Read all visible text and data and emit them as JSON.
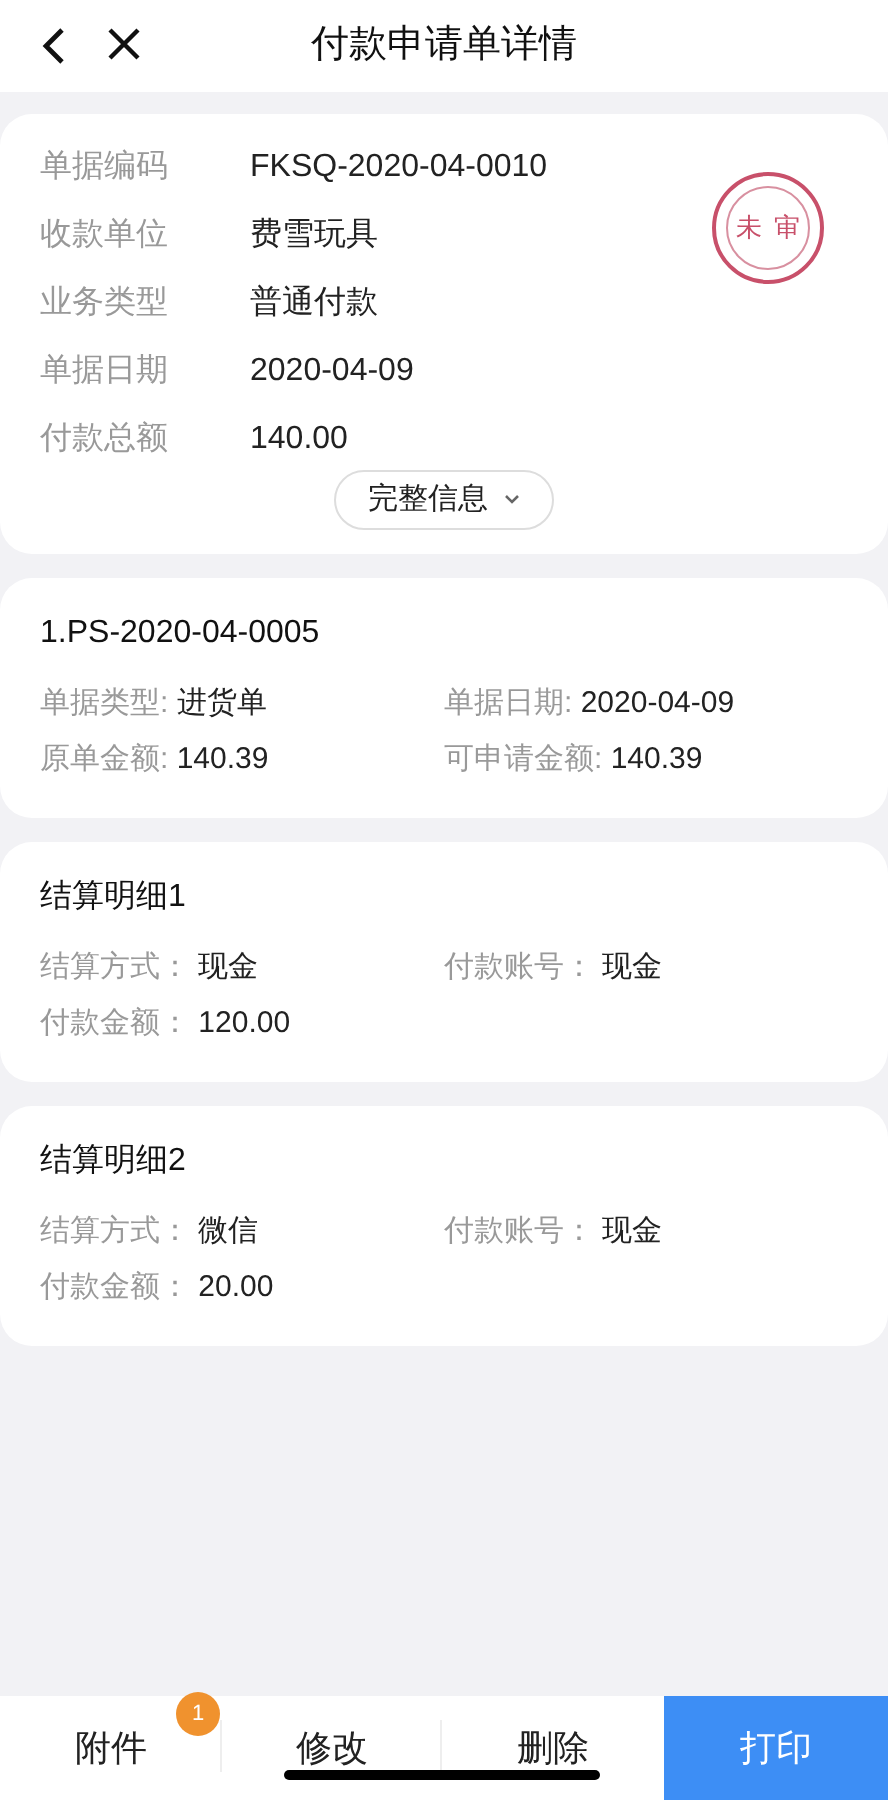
{
  "header": {
    "title": "付款申请单详情"
  },
  "summary": {
    "fields": [
      {
        "label": "单据编码",
        "value": "FKSQ-2020-04-0010"
      },
      {
        "label": "收款单位",
        "value": "费雪玩具"
      },
      {
        "label": "业务类型",
        "value": "普通付款"
      },
      {
        "label": "单据日期",
        "value": "2020-04-09"
      },
      {
        "label": "付款总额",
        "value": "140.00"
      }
    ],
    "stamp": "未审",
    "more_button": "完整信息"
  },
  "sections": [
    {
      "title": "1.PS-2020-04-0005",
      "fields": [
        {
          "label": "单据类型: ",
          "value": "进货单"
        },
        {
          "label": "单据日期: ",
          "value": "2020-04-09"
        },
        {
          "label": "原单金额: ",
          "value": "140.39"
        },
        {
          "label": "可申请金额: ",
          "value": "140.39"
        }
      ]
    },
    {
      "title": "结算明细1",
      "fields": [
        {
          "label": "结算方式： ",
          "value": "现金"
        },
        {
          "label": "付款账号： ",
          "value": "现金"
        },
        {
          "label": "付款金额： ",
          "value": "120.00"
        }
      ]
    },
    {
      "title": "结算明细2",
      "fields": [
        {
          "label": "结算方式： ",
          "value": "微信"
        },
        {
          "label": "付款账号： ",
          "value": "现金"
        },
        {
          "label": "付款金额： ",
          "value": "20.00"
        }
      ]
    }
  ],
  "bottom_bar": {
    "actions": [
      {
        "label": "附件",
        "badge": "1",
        "kind": "plain"
      },
      {
        "label": "修改",
        "kind": "plain"
      },
      {
        "label": "删除",
        "kind": "plain"
      },
      {
        "label": "打印",
        "kind": "primary"
      }
    ]
  }
}
